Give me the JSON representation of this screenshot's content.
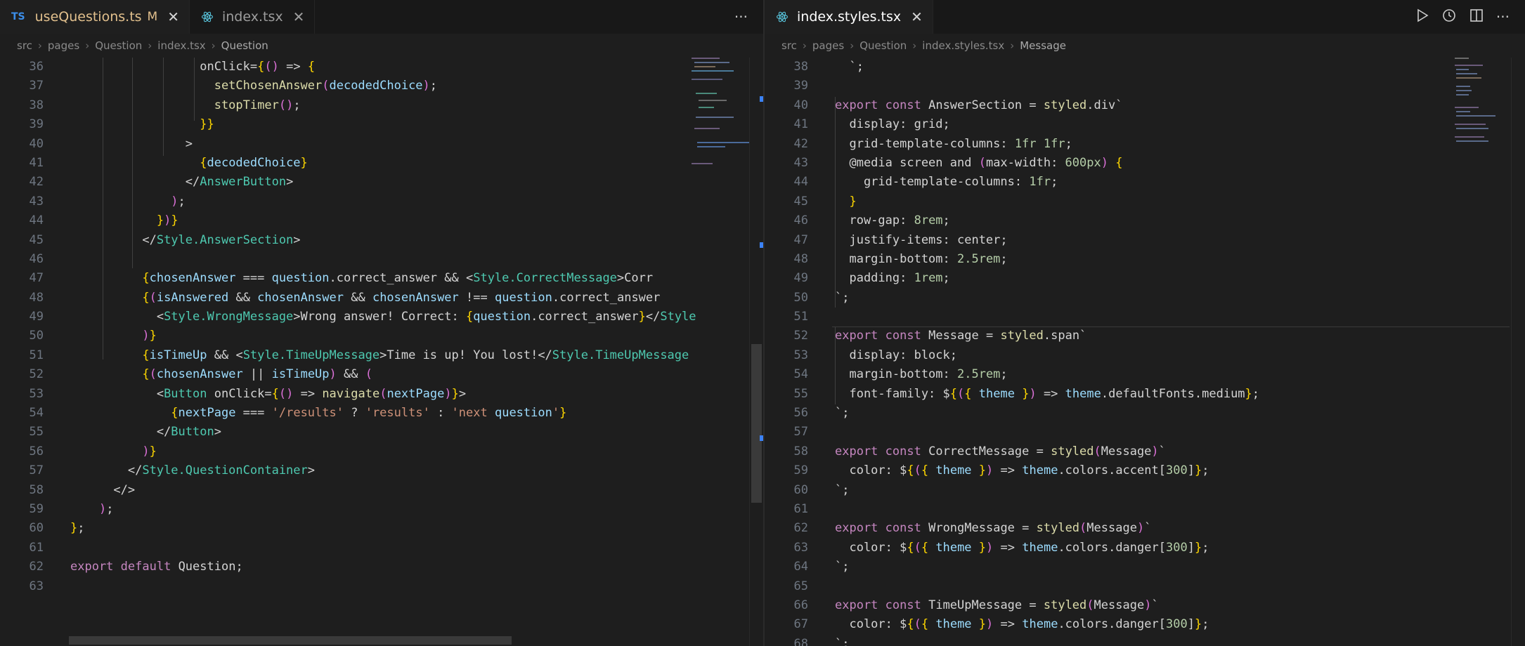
{
  "left": {
    "tabs": [
      {
        "icon": "TS",
        "label": "useQuestions.ts",
        "modified": "M",
        "active": true
      },
      {
        "icon": "react",
        "label": "index.tsx",
        "active": false
      }
    ],
    "more_label": "···",
    "breadcrumb": [
      "src",
      "pages",
      "Question",
      "index.tsx",
      "Question"
    ],
    "lines": [
      {
        "n": "36",
        "t": "                  onClick={() => {"
      },
      {
        "n": "37",
        "t": "                    setChosenAnswer(decodedChoice);"
      },
      {
        "n": "38",
        "t": "                    stopTimer();"
      },
      {
        "n": "39",
        "t": "                  }}"
      },
      {
        "n": "40",
        "t": "                >"
      },
      {
        "n": "41",
        "t": "                  {decodedChoice}"
      },
      {
        "n": "42",
        "t": "                </AnswerButton>"
      },
      {
        "n": "43",
        "t": "              );"
      },
      {
        "n": "44",
        "t": "            })}"
      },
      {
        "n": "45",
        "t": "          </Style.AnswerSection>"
      },
      {
        "n": "46",
        "t": ""
      },
      {
        "n": "47",
        "t": "          {chosenAnswer === question.correct_answer && <Style.CorrectMessage>Corr"
      },
      {
        "n": "48",
        "t": "          {(isAnswered && chosenAnswer && chosenAnswer !== question.correct_answer"
      },
      {
        "n": "49",
        "t": "            <Style.WrongMessage>Wrong answer! Correct: {question.correct_answer}</Style"
      },
      {
        "n": "50",
        "t": "          )}"
      },
      {
        "n": "51",
        "t": "          {isTimeUp && <Style.TimeUpMessage>Time is up! You lost!</Style.TimeUpMessage"
      },
      {
        "n": "52",
        "t": "          {(chosenAnswer || isTimeUp) && ("
      },
      {
        "n": "53",
        "t": "            <Button onClick={() => navigate(nextPage)}>"
      },
      {
        "n": "54",
        "t": "              {nextPage === '/results' ? 'results' : 'next question'}"
      },
      {
        "n": "55",
        "t": "            </Button>"
      },
      {
        "n": "56",
        "t": "          )}"
      },
      {
        "n": "57",
        "t": "        </Style.QuestionContainer>"
      },
      {
        "n": "58",
        "t": "      </>"
      },
      {
        "n": "59",
        "t": "    );"
      },
      {
        "n": "60",
        "t": "};"
      },
      {
        "n": "61",
        "t": ""
      },
      {
        "n": "62",
        "t": "export default Question;"
      },
      {
        "n": "63",
        "t": ""
      }
    ]
  },
  "right": {
    "tabs": [
      {
        "icon": "react",
        "label": "index.styles.tsx",
        "active": true
      }
    ],
    "breadcrumb": [
      "src",
      "pages",
      "Question",
      "index.styles.tsx",
      "Message"
    ],
    "lines": [
      {
        "n": "38",
        "t": "  `;"
      },
      {
        "n": "39",
        "t": ""
      },
      {
        "n": "40",
        "t": "export const AnswerSection = styled.div`"
      },
      {
        "n": "41",
        "t": "  display: grid;"
      },
      {
        "n": "42",
        "t": "  grid-template-columns: 1fr 1fr;"
      },
      {
        "n": "43",
        "t": "  @media screen and (max-width: 600px) {"
      },
      {
        "n": "44",
        "t": "    grid-template-columns: 1fr;"
      },
      {
        "n": "45",
        "t": "  }"
      },
      {
        "n": "46",
        "t": "  row-gap: 8rem;"
      },
      {
        "n": "47",
        "t": "  justify-items: center;"
      },
      {
        "n": "48",
        "t": "  margin-bottom: 2.5rem;"
      },
      {
        "n": "49",
        "t": "  padding: 1rem;"
      },
      {
        "n": "50",
        "t": "`;"
      },
      {
        "n": "51",
        "t": ""
      },
      {
        "n": "52",
        "t": "export const Message = styled.span`"
      },
      {
        "n": "53",
        "t": "  display: block;"
      },
      {
        "n": "54",
        "t": "  margin-bottom: 2.5rem;"
      },
      {
        "n": "55",
        "t": "  font-family: ${({ theme }) => theme.defaultFonts.medium};"
      },
      {
        "n": "56",
        "t": "`;"
      },
      {
        "n": "57",
        "t": ""
      },
      {
        "n": "58",
        "t": "export const CorrectMessage = styled(Message)`"
      },
      {
        "n": "59",
        "t": "  color: ${({ theme }) => theme.colors.accent[300]};"
      },
      {
        "n": "60",
        "t": "`;"
      },
      {
        "n": "61",
        "t": ""
      },
      {
        "n": "62",
        "t": "export const WrongMessage = styled(Message)`"
      },
      {
        "n": "63",
        "t": "  color: ${({ theme }) => theme.colors.danger[300]};"
      },
      {
        "n": "64",
        "t": "`;"
      },
      {
        "n": "65",
        "t": ""
      },
      {
        "n": "66",
        "t": "export const TimeUpMessage = styled(Message)`"
      },
      {
        "n": "67",
        "t": "  color: ${({ theme }) => theme.colors.danger[300]};"
      },
      {
        "n": "68",
        "t": "`;"
      }
    ]
  },
  "actions": {
    "run_icon": "play-icon",
    "timeline_icon": "history-icon",
    "split_icon": "split-editor-icon"
  },
  "colors": {
    "tab_active_bg": "#1f1f1f",
    "tab_bar_bg": "#181818",
    "editor_bg": "#1e1e1e",
    "modified": "#e2c08d",
    "ts_blue": "#3b8eea",
    "react_blue": "#58c4dc"
  }
}
